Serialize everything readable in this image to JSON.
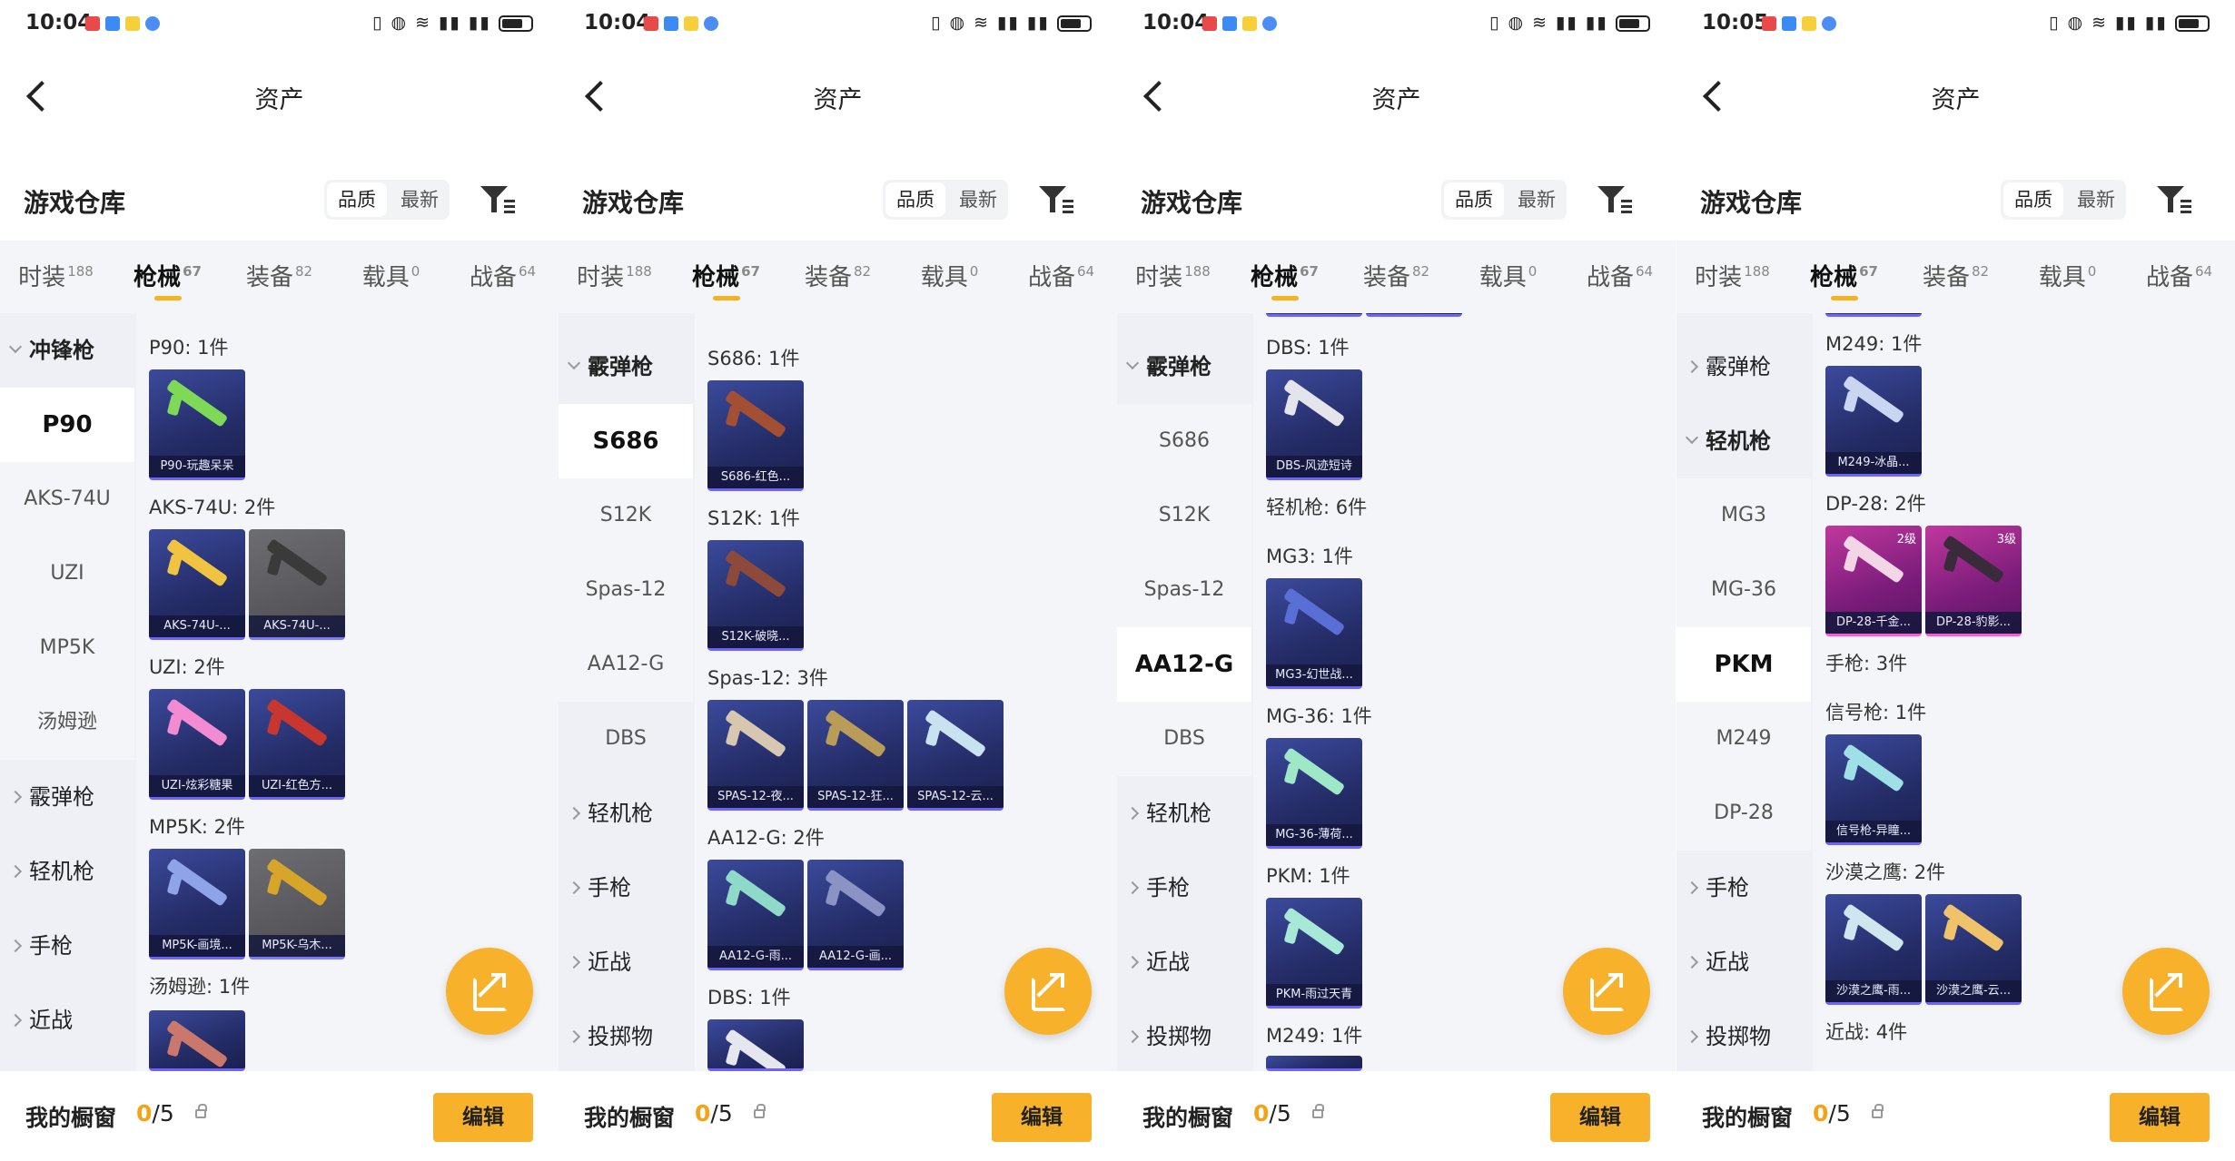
{
  "screens": [
    {
      "status_time": "10:04",
      "nav_title": "资产",
      "warehouse_title": "游戏仓库",
      "sort": [
        "品质",
        "最新"
      ],
      "tabs": [
        [
          "时装",
          "188"
        ],
        [
          "枪械",
          "67"
        ],
        [
          "装备",
          "82"
        ],
        [
          "载具",
          "0"
        ],
        [
          "战备",
          "64"
        ]
      ],
      "sidebar": [
        "冲锋枪",
        "P90",
        "AKS-74U",
        "UZI",
        "MP5K",
        "汤姆逊",
        "霰弹枪",
        "轻机枪",
        "手枪",
        "近战"
      ],
      "groups": [
        "P90: 1件",
        "AKS-74U: 2件",
        "UZI: 2件",
        "MP5K: 2件",
        "汤姆逊: 1件"
      ],
      "cards": [
        "P90-玩趣呆呆",
        "AKS-74U-...",
        "AKS-74U-...",
        "UZI-炫彩糖果",
        "UZI-红色方...",
        "MP5K-画境...",
        "MP5K-乌木..."
      ],
      "showcase_label": "我的橱窗",
      "showcase_count_a": "0",
      "showcase_count_b": "/5",
      "edit_label": "编辑"
    },
    {
      "status_time": "10:04",
      "nav_title": "资产",
      "warehouse_title": "游戏仓库",
      "sort": [
        "品质",
        "最新"
      ],
      "tabs": [
        [
          "时装",
          "188"
        ],
        [
          "枪械",
          "67"
        ],
        [
          "装备",
          "82"
        ],
        [
          "载具",
          "0"
        ],
        [
          "战备",
          "64"
        ]
      ],
      "sidebar": [
        "霰弹枪",
        "S686",
        "S12K",
        "Spas-12",
        "AA12-G",
        "DBS",
        "轻机枪",
        "手枪",
        "近战",
        "投掷物"
      ],
      "groups": [
        "S686: 1件",
        "S12K: 1件",
        "Spas-12: 3件",
        "AA12-G: 2件",
        "DBS: 1件"
      ],
      "cards": [
        "S686-红色...",
        "S12K-破晓...",
        "SPAS-12-夜...",
        "SPAS-12-狂...",
        "SPAS-12-云...",
        "AA12-G-雨...",
        "AA12-G-画..."
      ],
      "showcase_label": "我的橱窗",
      "showcase_count_a": "0",
      "showcase_count_b": "/5",
      "edit_label": "编辑"
    },
    {
      "status_time": "10:04",
      "nav_title": "资产",
      "warehouse_title": "游戏仓库",
      "sort": [
        "品质",
        "最新"
      ],
      "tabs": [
        [
          "时装",
          "188"
        ],
        [
          "枪械",
          "67"
        ],
        [
          "装备",
          "82"
        ],
        [
          "载具",
          "0"
        ],
        [
          "战备",
          "64"
        ]
      ],
      "sidebar": [
        "霰弹枪",
        "S686",
        "S12K",
        "Spas-12",
        "AA12-G",
        "DBS",
        "轻机枪",
        "手枪",
        "近战",
        "投掷物"
      ],
      "groups": [
        "DBS: 1件",
        "轻机枪: 6件",
        "MG3: 1件",
        "MG-36: 1件",
        "PKM: 1件",
        "M249: 1件"
      ],
      "cards": [
        "DBS-风迹短诗",
        "MG3-幻世战...",
        "MG-36-薄荷...",
        "PKM-雨过天青"
      ],
      "showcase_label": "我的橱窗",
      "showcase_count_a": "0",
      "showcase_count_b": "/5",
      "edit_label": "编辑"
    },
    {
      "status_time": "10:05",
      "nav_title": "资产",
      "warehouse_title": "游戏仓库",
      "sort": [
        "品质",
        "最新"
      ],
      "tabs": [
        [
          "时装",
          "188"
        ],
        [
          "枪械",
          "67"
        ],
        [
          "装备",
          "82"
        ],
        [
          "载具",
          "0"
        ],
        [
          "战备",
          "64"
        ]
      ],
      "sidebar": [
        "霰弹枪",
        "轻机枪",
        "MG3",
        "MG-36",
        "PKM",
        "M249",
        "DP-28",
        "手枪",
        "近战",
        "投掷物"
      ],
      "groups": [
        "M249: 1件",
        "DP-28: 2件",
        "手枪: 3件",
        "信号枪: 1件",
        "沙漠之鹰: 2件",
        "近战: 4件"
      ],
      "cards": [
        "M249-冰晶...",
        "DP-28-千金...",
        "DP-28-豹影...",
        "信号枪-异瞳...",
        "沙漠之鹰-雨...",
        "沙漠之鹰-云..."
      ],
      "card_levels": [
        "2级",
        "3级"
      ],
      "showcase_label": "我的橱窗",
      "showcase_count_a": "0",
      "showcase_count_b": "/5",
      "edit_label": "编辑"
    }
  ]
}
